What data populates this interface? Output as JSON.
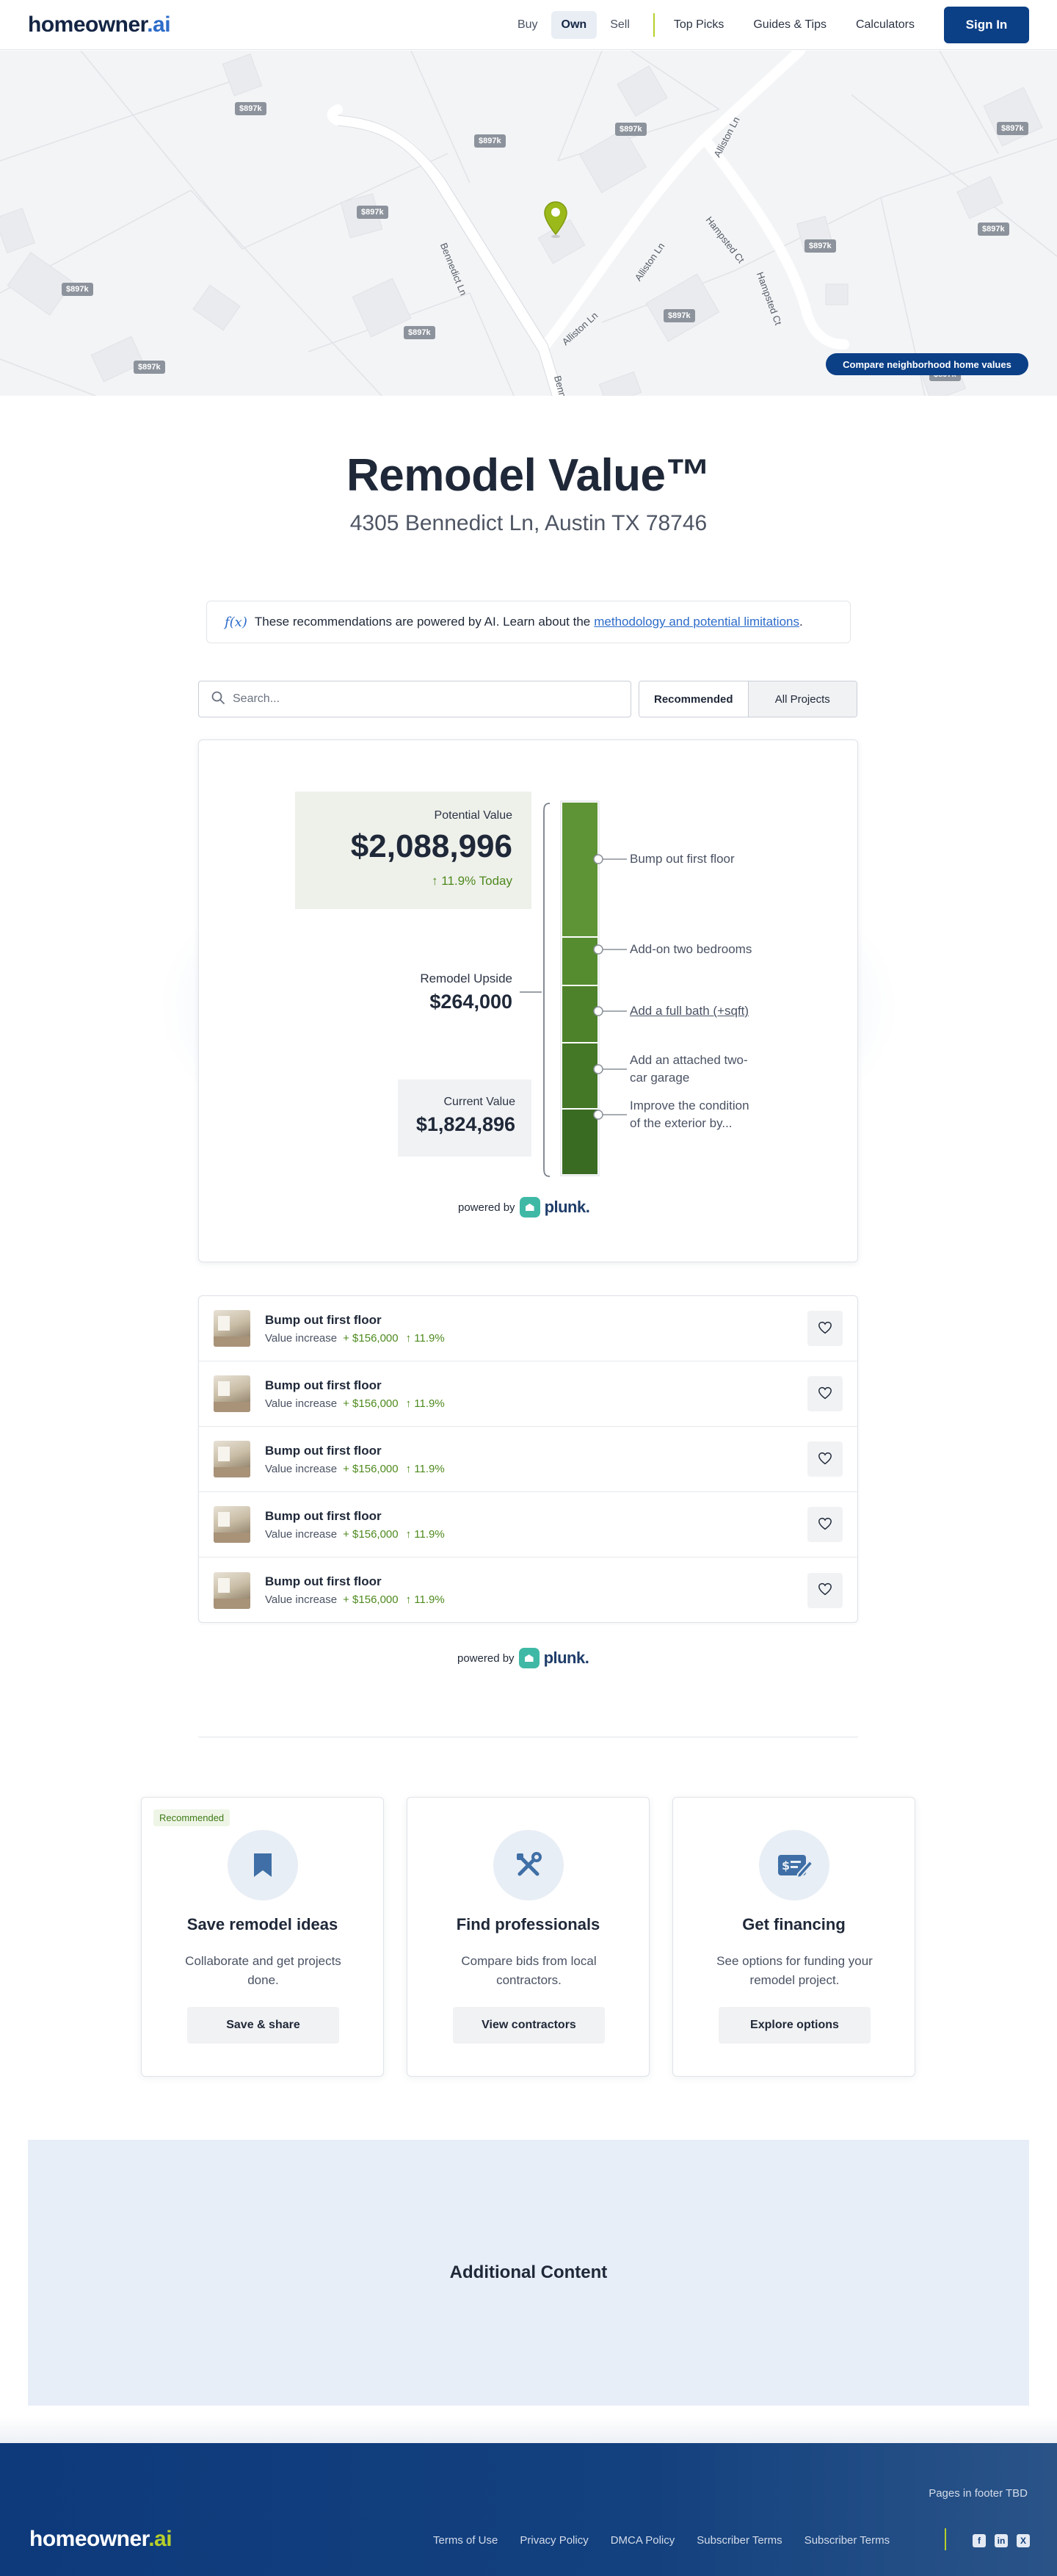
{
  "header": {
    "logo_main": "homeowner",
    "logo_tld": ".ai",
    "segments": [
      "Buy",
      "Own",
      "Sell"
    ],
    "active_segment": "Own",
    "links": [
      "Top Picks",
      "Guides & Tips",
      "Calculators"
    ],
    "signin_label": "Sign In"
  },
  "map": {
    "price_label": "$897k",
    "streets": [
      "Bennedict Ln",
      "Alliston Ln",
      "Alliston Ln",
      "Hampsted Ct",
      "Hampsted Ct",
      "Benn"
    ],
    "compare_label": "Compare neighborhood home values"
  },
  "title": {
    "heading": "Remodel Value™",
    "address": "4305 Bennedict Ln, Austin TX 78746"
  },
  "ai_note": {
    "icon": "f(x)",
    "text": "These recommendations are powered by AI. Learn about the",
    "link": "methodology and potential limitations",
    "end": "."
  },
  "search": {
    "placeholder": "Search...",
    "views": [
      "Recommended",
      "All Projects"
    ],
    "selected_view": "Recommended"
  },
  "value": {
    "potential_label": "Potential Value",
    "potential_value": "$2,088,996",
    "potential_change": "↑ 11.9%  Today",
    "upside_label": "Remodel Upside",
    "upside_value": "$264,000",
    "current_label": "Current Value",
    "current_value": "$1,824,896",
    "projects": [
      "Bump out first floor",
      "Add-on two bedrooms",
      "Add a full bath (+sqft)",
      "Add an attached two-car garage",
      "Improve the condition of the exterior by..."
    ],
    "colors": {
      "bar_top": "#5e9436",
      "bar_bottom": "#3a6b22"
    }
  },
  "powered": {
    "prefix": "powered by",
    "brand": "plunk",
    "suffix": "."
  },
  "project_list": [
    {
      "title": "Bump out first floor",
      "meta_label": "Value increase",
      "increase": "+ $156,000",
      "pct": "↑ 11.9%"
    },
    {
      "title": "Bump out first floor",
      "meta_label": "Value increase",
      "increase": "+ $156,000",
      "pct": "↑ 11.9%"
    },
    {
      "title": "Bump out first floor",
      "meta_label": "Value increase",
      "increase": "+ $156,000",
      "pct": "↑ 11.9%"
    },
    {
      "title": "Bump out first floor",
      "meta_label": "Value increase",
      "increase": "+ $156,000",
      "pct": "↑ 11.9%"
    },
    {
      "title": "Bump out first floor",
      "meta_label": "Value increase",
      "increase": "+ $156,000",
      "pct": "↑ 11.9%"
    }
  ],
  "features": [
    {
      "badge": "Recommended",
      "icon": "bookmark-icon",
      "title": "Save remodel ideas",
      "desc": "Collaborate and get projects done.",
      "button": "Save & share"
    },
    {
      "badge": "",
      "icon": "tools-icon",
      "title": "Find professionals",
      "desc": "Compare bids from local contractors.",
      "button": "View contractors"
    },
    {
      "badge": "",
      "icon": "financing-icon",
      "title": "Get financing",
      "desc": "See options for funding your remodel project.",
      "button": "Explore options"
    }
  ],
  "additional": {
    "label": "Additional Content"
  },
  "footer": {
    "tbd": "Pages in footer TBD",
    "logo_main": "homeowner",
    "logo_tld": ".ai",
    "links": [
      "Terms of Use",
      "Privacy Policy",
      "DMCA Policy",
      "Subscriber Terms",
      "Subscriber Terms"
    ],
    "social": [
      "facebook-icon",
      "linkedin-icon",
      "x-icon"
    ]
  }
}
